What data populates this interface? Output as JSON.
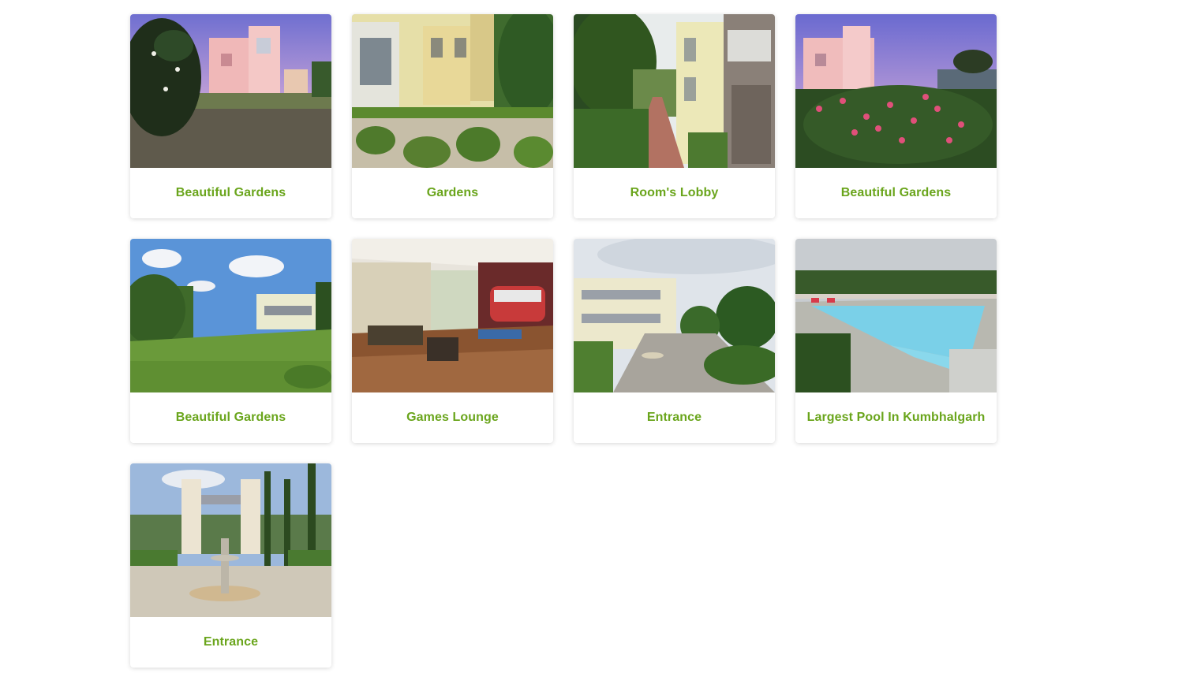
{
  "gallery": {
    "items": [
      {
        "caption": "Beautiful Gardens",
        "scene": "villa-lawn-dusk"
      },
      {
        "caption": "Gardens",
        "scene": "villa-courtyard"
      },
      {
        "caption": "Room's Lobby",
        "scene": "lobby-walkway"
      },
      {
        "caption": "Beautiful Gardens",
        "scene": "flower-bushes"
      },
      {
        "caption": "Beautiful Gardens",
        "scene": "wide-lawn"
      },
      {
        "caption": "Games Lounge",
        "scene": "lounge-interior"
      },
      {
        "caption": "Entrance",
        "scene": "entrance-drive"
      },
      {
        "caption": "Largest Pool In Kumbhalgarh",
        "scene": "swimming-pool"
      },
      {
        "caption": "Entrance",
        "scene": "entrance-fountain-gate"
      }
    ]
  },
  "colors": {
    "caption_text": "#6aa51c",
    "card_background": "#ffffff",
    "page_background": "#ffffff"
  }
}
